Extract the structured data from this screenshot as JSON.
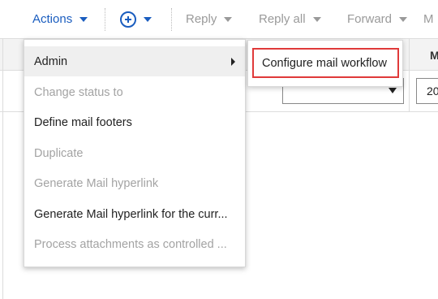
{
  "toolbar": {
    "actions_label": "Actions",
    "reply_label": "Reply",
    "reply_all_label": "Reply all",
    "forward_label": "Forward",
    "more_label": "M"
  },
  "grid": {
    "column_header_partial": "M",
    "filter_input_value": "20"
  },
  "menu": {
    "items": [
      {
        "label": "Admin",
        "state": "active",
        "has_submenu": true
      },
      {
        "label": "Change status to",
        "state": "disabled"
      },
      {
        "label": "Define mail footers",
        "state": "enabled"
      },
      {
        "label": "Duplicate",
        "state": "disabled"
      },
      {
        "label": "Generate Mail hyperlink",
        "state": "disabled"
      },
      {
        "label": "Generate Mail hyperlink for the curr...",
        "state": "enabled"
      },
      {
        "label": "Process attachments as controlled ...",
        "state": "disabled"
      }
    ]
  },
  "submenu": {
    "items": [
      {
        "label": "Configure mail workflow",
        "highlight_color": "#e03a3a"
      }
    ]
  },
  "colors": {
    "accent": "#1a5dbf",
    "disabled_text": "#a3a3a3",
    "highlight_border": "#e03a3a"
  }
}
